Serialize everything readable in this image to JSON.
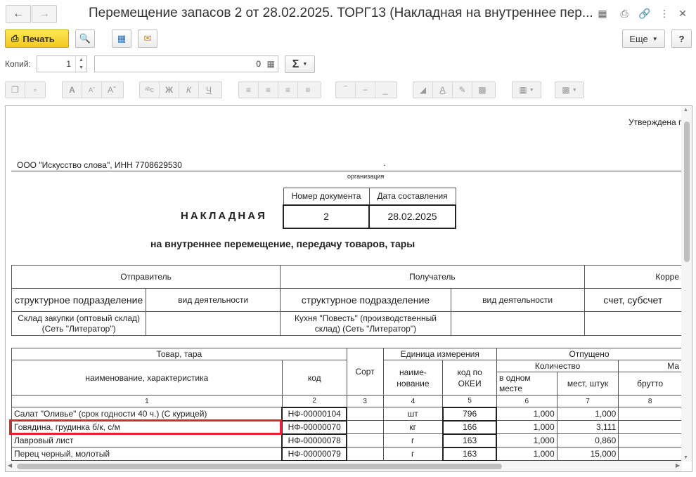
{
  "window": {
    "title": "Перемещение запасов 2 от 28.02.2025. ТОРГ13 (Накладная на внутреннее пер...",
    "back_icon": "arrow-left-icon",
    "forward_icon": "arrow-right-icon"
  },
  "toolbar": {
    "print_label": "Печать",
    "more_label": "Еще",
    "help_label": "?"
  },
  "copies": {
    "label": "Копий:",
    "value": "1",
    "sum_value": "0",
    "sum_symbol": "Σ"
  },
  "doc": {
    "approved": "Утверждена г",
    "org": "ООО \"Искусство слова\",  ИНН 7708629530",
    "dot": ".",
    "org_caption": "организация",
    "doc_number_header": "Номер документа",
    "doc_date_header": "Дата составления",
    "doc_number": "2",
    "doc_date": "28.02.2025",
    "heading": "НАКЛАДНАЯ",
    "subheading": "на внутреннее перемещение, передачу товаров, тары",
    "parties": {
      "sender": "Отправитель",
      "receiver": "Получатель",
      "corr": "Корре",
      "struct_div": "структурное подразделение",
      "activity": "вид деятельности",
      "struct_div2": "структурное подразделение",
      "activity2": "вид деятельности",
      "account": "счет, субсчет",
      "sender_value": "Склад закупки (оптовый склад) (Сеть \"Литератор\")",
      "receiver_value": "Кухня \"Повесть\" (производственный склад)  (Сеть \"Литератор\")"
    },
    "goods": {
      "h_goods": "Товар, тара",
      "h_name": "наименование, характеристика",
      "h_code": "код",
      "h_sort": "Сорт",
      "h_unit": "Единица измерения",
      "h_unit_name": "наиме- нование",
      "h_okei": "код по ОКЕИ",
      "h_released": "Отпущено",
      "h_qty": "Количество",
      "h_in_one": "в одном месте",
      "h_places": "мест, штук",
      "h_mass": "Ма",
      "h_gross": "брутто",
      "nums": [
        "1",
        "2",
        "3",
        "4",
        "5",
        "6",
        "7",
        "8"
      ],
      "rows": [
        {
          "name": "Салат \"Оливье\" (срок годности 40 ч.) (С курицей)",
          "code": "НФ-00000104",
          "unit": "шт",
          "okei": "796",
          "in_one": "1,000",
          "places": "1,000"
        },
        {
          "name": "Говядина, грудинка б/к, с/м",
          "code": "НФ-00000070",
          "unit": "кг",
          "okei": "166",
          "in_one": "1,000",
          "places": "3,111"
        },
        {
          "name": "Лавровый лист",
          "code": "НФ-00000078",
          "unit": "г",
          "okei": "163",
          "in_one": "1,000",
          "places": "0,860"
        },
        {
          "name": "Перец черный, молотый",
          "code": "НФ-00000079",
          "unit": "г",
          "okei": "163",
          "in_one": "1,000",
          "places": "15,000"
        }
      ]
    }
  }
}
